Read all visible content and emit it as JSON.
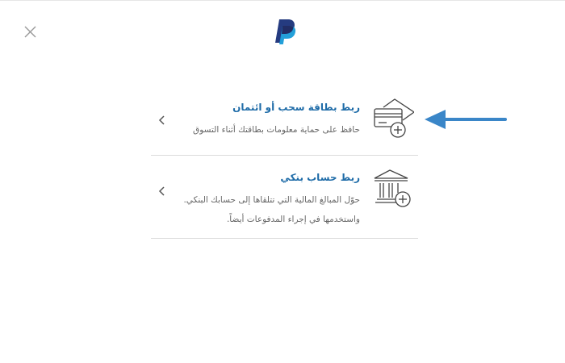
{
  "dialog": {
    "close_icon": "close-icon",
    "logo": "paypal-logo"
  },
  "options": [
    {
      "icon": "card-add-icon",
      "title": "ربط بطاقة سحب أو ائتمان",
      "description": "حافظ على حماية معلومات بطاقتك أثناء التسوق"
    },
    {
      "icon": "bank-add-icon",
      "title": "ربط حساب بنكي",
      "description_line1": "حوّل المبالغ المالية التي تتلقاها إلى حسابك البنكي.",
      "description_line2": "واستخدمها في إجراء المدفوعات أيضاً."
    }
  ],
  "colors": {
    "title_blue": "#1f6ca8",
    "annotation_arrow": "#3a86c8",
    "paypal_dark": "#253b80",
    "paypal_light": "#179bd7"
  }
}
